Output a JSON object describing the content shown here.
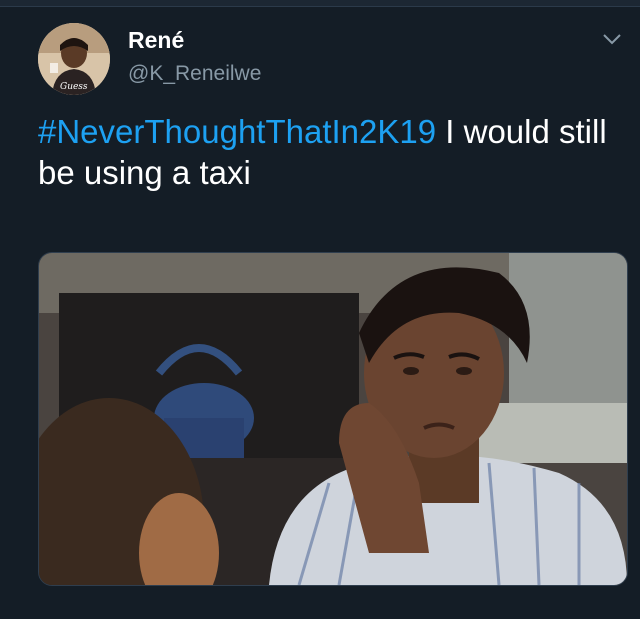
{
  "tweet": {
    "author": {
      "display_name": "René",
      "handle": "@K_Reneilwe",
      "avatar_icon": "user-avatar"
    },
    "text": {
      "hashtag": "#NeverThoughtThatIn2K19",
      "body": " I would still be using a taxi"
    },
    "menu_icon": "chevron-down-icon",
    "media": {
      "type": "image",
      "description_icon": "photo"
    }
  },
  "colors": {
    "background": "#141d26",
    "hashtag": "#1da1f2",
    "handle": "#8899a6",
    "text": "#ffffff"
  }
}
